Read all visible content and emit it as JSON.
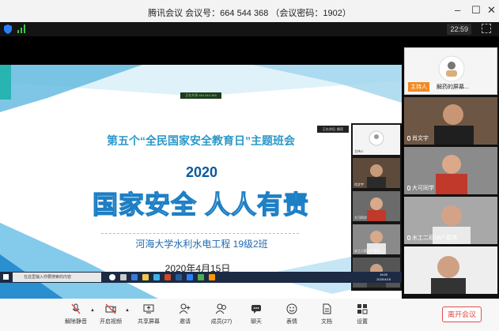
{
  "window": {
    "title": "腾讯会议 会议号：664 544 368  （会议密码：1902）",
    "clock": "22:59"
  },
  "slide": {
    "share_badge": "正在共享 664 544 368",
    "title": "第五个“全民国家安全教育日”主题班会",
    "year": "2020",
    "slogan": "国家安全  人人有责",
    "class": "河海大学水利水电工程  19级2班",
    "date": "2020年4月15日",
    "popup": "正在讲话: 解药"
  },
  "mini_strip": [
    {
      "name": "主持人"
    },
    {
      "name": "肖文宇"
    },
    {
      "name": "大可同学"
    },
    {
      "name": "水工二班18产葛琪"
    },
    {
      "name": ""
    }
  ],
  "taskbar": {
    "search_placeholder": "在这里输入你要搜索的内容",
    "time": "16:00",
    "date": "2020/4/15"
  },
  "gallery": [
    {
      "host_badge": "主持人",
      "name": "解药的屏幕..."
    },
    {
      "name": "肖文宇"
    },
    {
      "name": "大可同学"
    },
    {
      "name": "水工二班18产葛琪"
    },
    {
      "name": ""
    }
  ],
  "toolbar": {
    "mute": "解除静音",
    "video": "开启视频",
    "share": "共享屏幕",
    "invite": "邀请",
    "members": "成员(27)",
    "chat": "聊天",
    "reactions": "表情",
    "docs": "文档",
    "settings": "设置",
    "leave": "离开会议"
  },
  "colors": {
    "accent": "#1d7fc4",
    "host": "#f08a24",
    "leave": "#e24b4b",
    "signal": "#3cc84a"
  }
}
